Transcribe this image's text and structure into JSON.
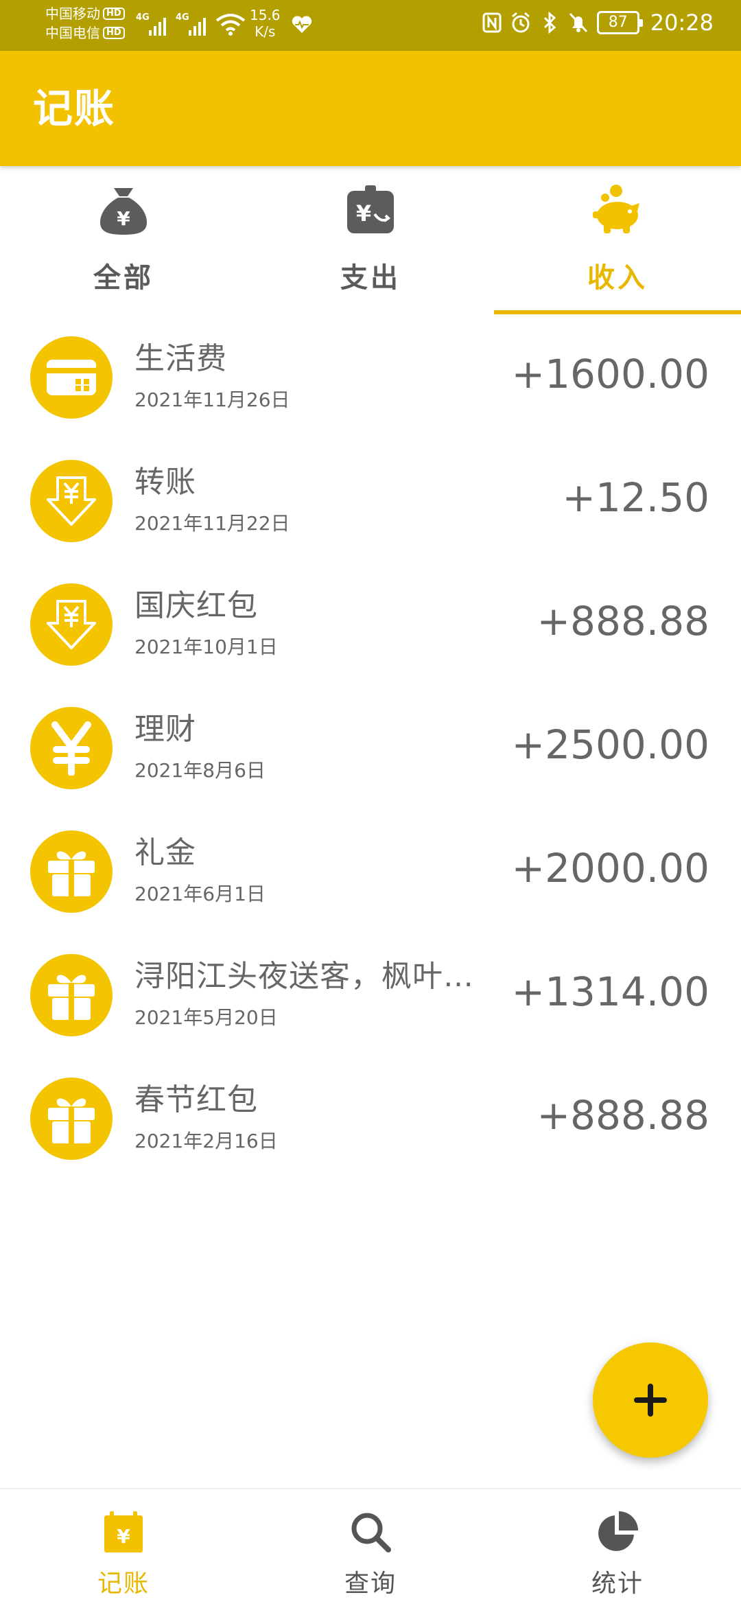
{
  "status_bar": {
    "carrier1": "中国移动",
    "carrier2": "中国电信",
    "hd": "HD",
    "network1": "4G",
    "network2": "4G",
    "speed_value": "15.6",
    "speed_unit": "K/s",
    "battery": "87",
    "time": "20:28"
  },
  "app_bar": {
    "title": "记账"
  },
  "tabs": [
    {
      "label": "全部",
      "icon": "money-bag-icon",
      "active": false
    },
    {
      "label": "支出",
      "icon": "wallet-yen-icon",
      "active": false
    },
    {
      "label": "收入",
      "icon": "piggy-bank-icon",
      "active": true
    }
  ],
  "records": [
    {
      "title": "生活费",
      "date": "2021年11月26日",
      "amount": "+1600.00",
      "icon": "card-icon"
    },
    {
      "title": "转账",
      "date": "2021年11月22日",
      "amount": "+12.50",
      "icon": "yen-down-arrow-icon"
    },
    {
      "title": "国庆红包",
      "date": "2021年10月1日",
      "amount": "+888.88",
      "icon": "yen-down-arrow-icon"
    },
    {
      "title": "理财",
      "date": "2021年8月6日",
      "amount": "+2500.00",
      "icon": "yen-icon"
    },
    {
      "title": "礼金",
      "date": "2021年6月1日",
      "amount": "+2000.00",
      "icon": "gift-icon"
    },
    {
      "title": "浔阳江头夜送客，枫叶…",
      "date": "2021年5月20日",
      "amount": "+1314.00",
      "icon": "gift-icon"
    },
    {
      "title": "春节红包",
      "date": "2021年2月16日",
      "amount": "+888.88",
      "icon": "gift-icon"
    }
  ],
  "fab": {
    "icon": "plus-icon"
  },
  "bottom_nav": [
    {
      "label": "记账",
      "icon": "ledger-yen-icon",
      "active": true
    },
    {
      "label": "查询",
      "icon": "search-icon",
      "active": false
    },
    {
      "label": "统计",
      "icon": "pie-chart-icon",
      "active": false
    }
  ],
  "colors": {
    "accent": "#f2c200",
    "status_bar": "#b3a000",
    "icon_circle": "#f5c400",
    "active_text": "#e8b800",
    "text": "#666666"
  }
}
